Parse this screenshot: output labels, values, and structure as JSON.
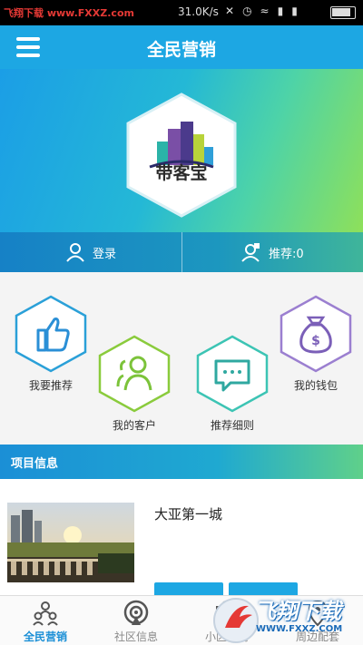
{
  "status_bar": {
    "watermark": "飞翔下载 www.FXXZ.com",
    "speed": "31.0K/s",
    "icons": [
      "mute-icon",
      "alarm-icon",
      "wifi-icon",
      "signal-icon",
      "signal-icon",
      "battery-icon"
    ]
  },
  "header": {
    "title": "全民营销",
    "menu_icon": "hamburger-icon"
  },
  "hero": {
    "logo_text": "带客宝"
  },
  "login_bar": {
    "login_label": "登录",
    "recommend_label": "推荐:0"
  },
  "menu": {
    "items": [
      {
        "label": "我要推荐",
        "icon": "thumbs-up-icon"
      },
      {
        "label": "我的客户",
        "icon": "customers-icon"
      },
      {
        "label": "推荐细则",
        "icon": "message-icon"
      },
      {
        "label": "我的钱包",
        "icon": "money-bag-icon"
      }
    ]
  },
  "project_section": {
    "title": "项目信息",
    "project_name": "大亚第一城"
  },
  "bottom_nav": {
    "items": [
      {
        "label": "全民营销",
        "icon": "people-icon",
        "active": true
      },
      {
        "label": "社区信息",
        "icon": "broadcast-icon",
        "active": false
      },
      {
        "label": "小区电商",
        "icon": "shop-icon",
        "active": false
      },
      {
        "label": "周边配套",
        "icon": "nearby-icon",
        "active": false
      }
    ]
  },
  "overlay_watermark": {
    "text": "飞翔下载",
    "url": "WWW.FXXZ.COM"
  },
  "colors": {
    "primary": "#1da7e3",
    "accent_green": "#8ee05a",
    "active_nav": "#1a8fd6"
  }
}
